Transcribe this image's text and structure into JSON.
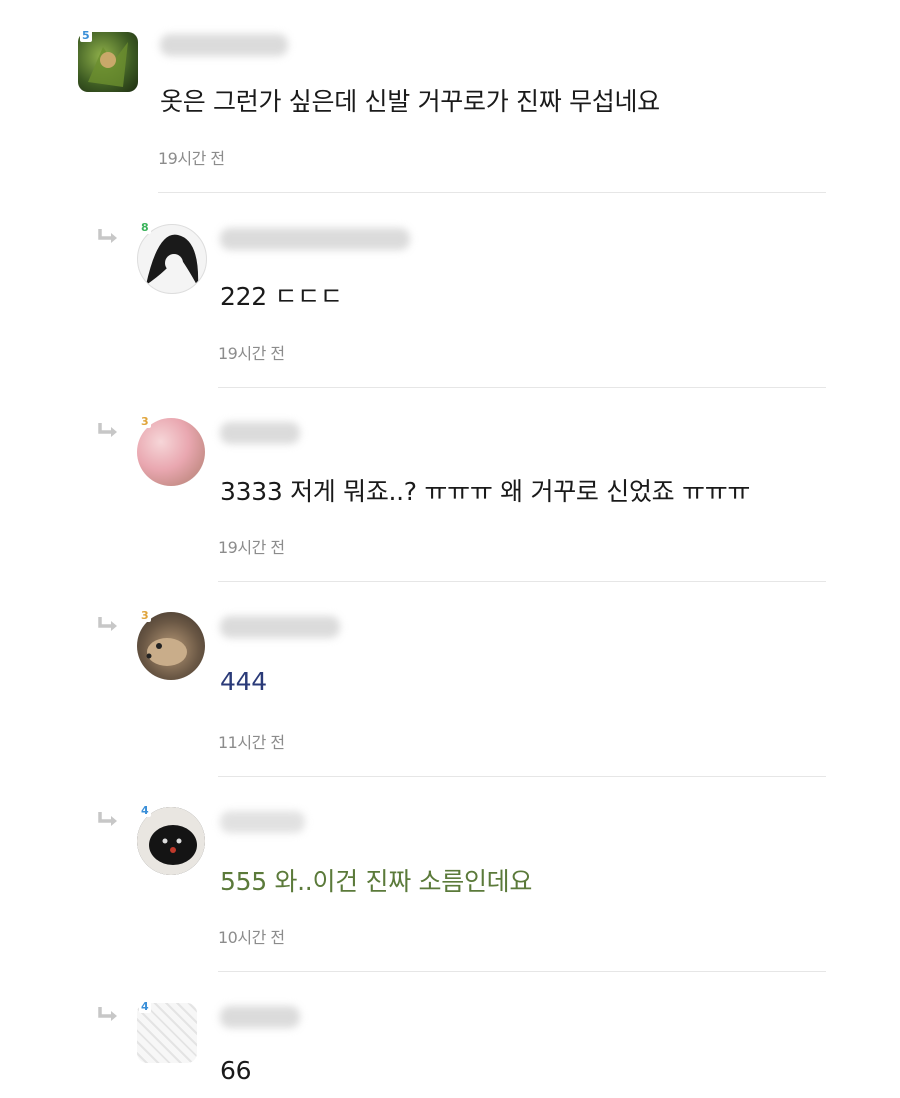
{
  "comments": [
    {
      "level": "5",
      "level_color": "#3a8fd8",
      "text": "옷은 그런가 싶은데 신발 거꾸로가 진짜 무섭네요",
      "text_color": "#1a1a1a",
      "time": "19시간 전",
      "avatar": "green-character-avatar"
    },
    {
      "level": "8",
      "level_color": "#3bb35b",
      "text": "222 ㄷㄷㄷ",
      "text_color": "#1a1a1a",
      "time": "19시간 전",
      "avatar": "anime-girl-avatar"
    },
    {
      "level": "3",
      "level_color": "#e0a43a",
      "text": "3333 저게 뭐죠..? ㅠㅠㅠ 왜 거꾸로 신었죠 ㅠㅠㅠ",
      "text_color": "#1a1a1a",
      "time": "19시간 전",
      "avatar": "pink-blossom-avatar"
    },
    {
      "level": "3",
      "level_color": "#e0a43a",
      "text": "444",
      "text_color": "#2a3a78",
      "time": "11시간 전",
      "avatar": "meerkat-avatar"
    },
    {
      "level": "4",
      "level_color": "#3a8fd8",
      "text": "555 와..이건 진짜 소름인데요",
      "text_color": "#5b7a3a",
      "time": "10시간 전",
      "avatar": "black-cat-avatar"
    },
    {
      "level": "4",
      "level_color": "#3a8fd8",
      "text": "66",
      "text_color": "#1a1a1a",
      "avatar": "pattern-avatar"
    }
  ]
}
